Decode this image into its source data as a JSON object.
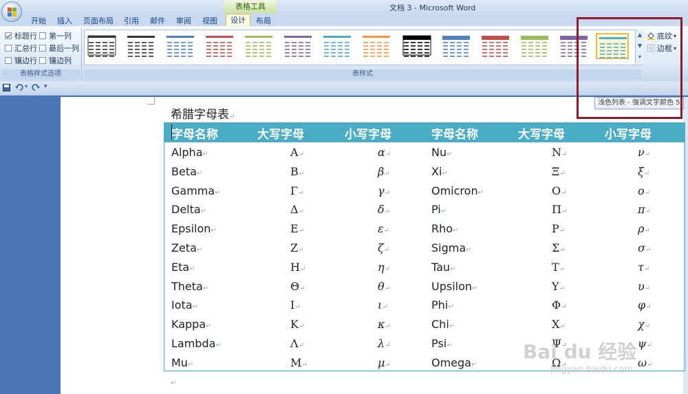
{
  "window": {
    "title": "文档 3 - Microsoft Word",
    "context_tab": "表格工具"
  },
  "tabs": [
    "开始",
    "插入",
    "页面布局",
    "引用",
    "邮件",
    "审阅",
    "视图",
    "设计",
    "布局"
  ],
  "active_tab": "设计",
  "style_options": {
    "label": "表格样式选项",
    "items": [
      {
        "label": "标题行",
        "checked": true
      },
      {
        "label": "第一列",
        "checked": false
      },
      {
        "label": "汇总行",
        "checked": false
      },
      {
        "label": "最后一列",
        "checked": false
      },
      {
        "label": "镶边行",
        "checked": false
      },
      {
        "label": "镶边列",
        "checked": false
      }
    ]
  },
  "table_styles": {
    "label": "表样式",
    "shading_label": "底纹",
    "borders_label": "边框",
    "tooltip": "浅色列表 - 强调文字颜色 5",
    "colors": [
      "#333333",
      "#333333",
      "#4f81bd",
      "#c0504d",
      "#9bbb59",
      "#8064a2",
      "#4bacc6",
      "#f79646",
      "#000000",
      "#4f81bd",
      "#c0504d",
      "#9bbb59",
      "#8064a2",
      "#4bacc6"
    ]
  },
  "document": {
    "heading": "希腊字母表",
    "table": {
      "headers": [
        "字母名称",
        "大写字母",
        "小写字母",
        "字母名称",
        "大写字母",
        "小写字母"
      ],
      "header_color": "#4bacc6",
      "rows": [
        [
          "Alpha",
          "Α",
          "α",
          "Nu",
          "Ν",
          "ν"
        ],
        [
          "Beta",
          "Β",
          "β",
          "Xi",
          "Ξ",
          "ξ"
        ],
        [
          "Gamma",
          "Γ",
          "γ",
          "Omicron",
          "Ο",
          "ο"
        ],
        [
          "Delta",
          "Δ",
          "δ",
          "Pi",
          "Π",
          "π"
        ],
        [
          "Epsilon",
          "Ε",
          "ε",
          "Rho",
          "Ρ",
          "ρ"
        ],
        [
          "Zeta",
          "Ζ",
          "ζ",
          "Sigma",
          "Σ",
          "σ"
        ],
        [
          "Eta",
          "Η",
          "η",
          "Tau",
          "Τ",
          "τ"
        ],
        [
          "Theta",
          "Θ",
          "θ",
          "Upsilon",
          "Υ",
          "υ"
        ],
        [
          "Iota",
          "Ι",
          "ι",
          "Phi",
          "Φ",
          "φ"
        ],
        [
          "Kappa",
          "Κ",
          "κ",
          "Chi",
          "Χ",
          "χ"
        ],
        [
          "Lambda",
          "Λ",
          "λ",
          "Psi",
          "Ψ",
          "ψ"
        ],
        [
          "Mu",
          "Μ",
          "μ",
          "Omega",
          "Ω",
          "ω"
        ]
      ]
    }
  },
  "watermark": {
    "text": "Bai du 经验",
    "url": "jingyan.baidu.com"
  }
}
